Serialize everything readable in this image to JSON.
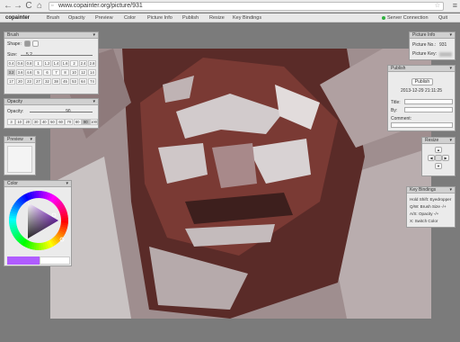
{
  "browser": {
    "url": "www.copainter.org/picture/931",
    "back_glyph": "←",
    "fwd_glyph": "→",
    "reload_glyph": "C",
    "home_glyph": "⌂",
    "star_glyph": "☆",
    "menu_glyph": "≡"
  },
  "app": {
    "brand": "copainter",
    "menu": [
      "Brush",
      "Opacity",
      "Preview",
      "Color",
      "Picture Info",
      "Publish",
      "Resize",
      "Key Bindings"
    ],
    "status": "Server Connection",
    "quit": "Quit"
  },
  "brush": {
    "title": "Brush",
    "shape_label": "Shape:",
    "size_label": "Size:",
    "size_value": "5.2",
    "sizes": [
      "0.4",
      "0.6",
      "0.8",
      "1",
      "1.2",
      "1.4",
      "1.6",
      "2",
      "2.4",
      "2.8",
      "3.2",
      "3.6",
      "4.6",
      "5",
      "6",
      "7",
      "8",
      "10",
      "12",
      "14",
      "17",
      "20",
      "23",
      "27",
      "32",
      "38",
      "45",
      "53",
      "64",
      "74"
    ],
    "selected": "3.2"
  },
  "opacity": {
    "title": "Opacity",
    "label": "Opacity:",
    "value": "90",
    "values": [
      "3",
      "10",
      "20",
      "30",
      "40",
      "50",
      "60",
      "70",
      "80",
      "90",
      "100"
    ],
    "selected": "90"
  },
  "preview": {
    "title": "Preview"
  },
  "color": {
    "title": "Color",
    "current": "#b05cff"
  },
  "picture_info": {
    "title": "Picture Info",
    "no_label": "Picture No.:",
    "no_value": "931",
    "key_label": "Picture Key:"
  },
  "publish": {
    "title": "Publish",
    "button": "Publish",
    "timestamp": "2013-12-29 21:11:25",
    "title_label": "Title:",
    "by_label": "By:",
    "comment_label": "Comment:"
  },
  "resize": {
    "title": "Resize",
    "arrows": [
      "▲",
      "◀",
      "▶",
      "▼"
    ]
  },
  "keys": {
    "title": "Key Bindings",
    "lines": [
      "Hold Shift: Eyedropper",
      "Q/W: Brush Size -/+",
      "A/S: Opacity -/+",
      "X: Switch Color"
    ]
  },
  "colors": {
    "accent": "#b05cff",
    "status_ok": "#2fb13f"
  }
}
